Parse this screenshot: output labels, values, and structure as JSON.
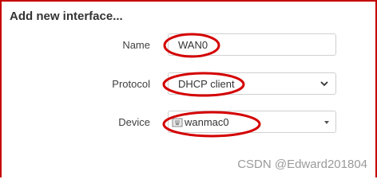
{
  "dialog": {
    "title": "Add new interface..."
  },
  "form": {
    "name": {
      "label": "Name",
      "value": "WAN0"
    },
    "protocol": {
      "label": "Protocol",
      "value": "DHCP client"
    },
    "device": {
      "label": "Device",
      "value": "wanmac0"
    }
  },
  "icons": {
    "protocol_dropdown": "chevron-down-icon",
    "device_dropdown": "caret-down-icon",
    "device_type": "ethernet-port-icon"
  },
  "annotations": {
    "highlight_color": "#d40000",
    "border_color": "#c40000"
  },
  "watermark": {
    "text": "CSDN @Edward201804"
  }
}
